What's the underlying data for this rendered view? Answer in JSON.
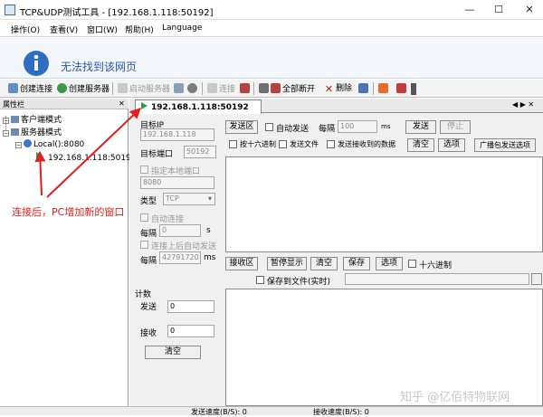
{
  "window": {
    "title": "TCP&UDP测试工具 - [192.168.1.118:50192]",
    "minimize": "—",
    "maximize": "☐",
    "close": "✕"
  },
  "menu": [
    {
      "label": "操作(O)"
    },
    {
      "label": "查看(V)"
    },
    {
      "label": "窗口(W)"
    },
    {
      "label": "帮助(H)"
    },
    {
      "label": "Language"
    }
  ],
  "banner": {
    "text": "无法找到该网页",
    "icon": "i"
  },
  "toolbar": {
    "create_connection": "创建连接",
    "create_server": "创建服务器",
    "start_server": "启动服务器",
    "connect": "连接",
    "disconnect_all": "全部断开",
    "delete": "删除"
  },
  "left": {
    "header": "属性栏",
    "pin": "✕",
    "tree": {
      "client_mode": "客户端模式",
      "server_mode": "服务器模式",
      "local": "Local():8080",
      "conn": "192.168.1.118:50192"
    }
  },
  "tab": {
    "label": "192.168.1.118:50192",
    "nav": "◀ ▶ ✕"
  },
  "target": {
    "ip_label": "目标IP",
    "ip_value": "192.168.1.118",
    "port_label": "目标端口",
    "port_value": "50192",
    "local_port_check": "指定本地端口",
    "local_port_value": "8080",
    "type_label": "类型",
    "type_value": "TCP",
    "auto_connect": "自动连接",
    "interval_label": "每隔",
    "interval_value": "0",
    "interval_unit": "s",
    "auto_send_after": "连接上后自动发送",
    "interval2_label": "每隔",
    "interval2_value": "42791720",
    "interval2_unit": "ms"
  },
  "count": {
    "title": "计数",
    "send_label": "发送",
    "send_value": "0",
    "recv_label": "接收",
    "recv_value": "0",
    "clear": "清空"
  },
  "send": {
    "area_label": "发送区",
    "auto_send": "自动发送",
    "interval_label": "每隔",
    "interval_value": "100",
    "interval_unit": "ms",
    "send_btn": "发送",
    "stop_btn": "停止",
    "hex": "按十六进制",
    "send_file": "发送文件",
    "send_recv_data": "发送接收到的数据",
    "clear": "清空",
    "options": "选项",
    "broadcast": "广播包发送选项"
  },
  "recv": {
    "area_label": "接收区",
    "pause": "暂停显示",
    "clear": "清空",
    "save": "保存",
    "options": "选项",
    "hex": "十六进制",
    "save_file": "保存到文件(实时)"
  },
  "status": {
    "send_speed": "发送速度(B/S): 0",
    "recv_speed": "接收速度(B/S): 0"
  },
  "annotation": {
    "text": "连接后，PC增加新的窗口"
  },
  "watermark": {
    "text": "知乎 @亿佰特物联网"
  },
  "colors": {
    "annot": "#e02020",
    "accent": "#2b59a8"
  }
}
